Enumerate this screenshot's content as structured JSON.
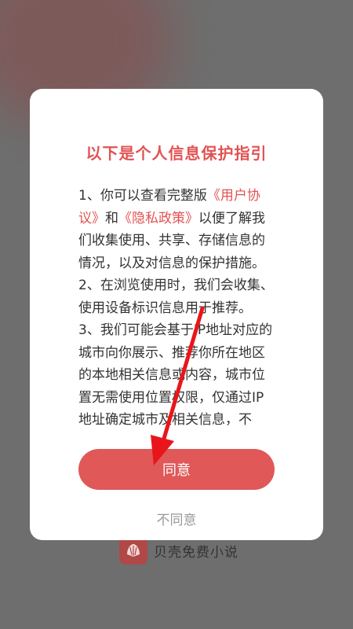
{
  "background": {
    "app_name": "贝壳免费小说",
    "app_icon": "shell-logo-icon"
  },
  "dialog": {
    "title": "以下是个人信息保护指引",
    "paragraph1": {
      "lead": "1、你可以查看完整版",
      "user_agreement_link": "《用户协议》",
      "connector": "和",
      "privacy_policy_link": "《隐私政策》",
      "tail": "以便了解我们收集使用、共享、存储信息的情况，以及对信息的保护措施。"
    },
    "paragraph2": " 2、在浏览使用时，我们会收集、使用设备标识信息用于推荐。",
    "paragraph3": " 3、我们可能会基于IP地址对应的城市向你展示、推荐你所在地区的本地相关信息或内容，城市位置无需使用位置权限，仅通过IP地址确定城市及相关信息，不",
    "agree_label": "同意",
    "disagree_label": "不同意"
  },
  "annotation": {
    "arrow_color": "#e8161b",
    "arrow_icon": "red-arrow-pointing-down-left"
  }
}
